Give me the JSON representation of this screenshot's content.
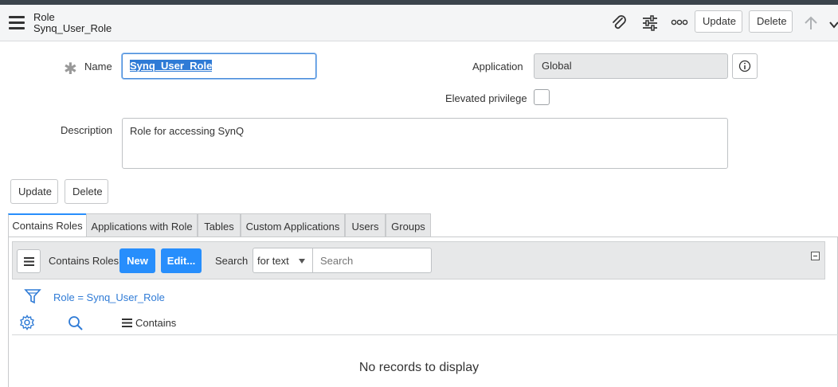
{
  "header": {
    "title": "Role",
    "subtitle": "Synq_User_Role",
    "update_label": "Update",
    "delete_label": "Delete"
  },
  "form": {
    "name_label": "Name",
    "name_value": "Synq_User_Role",
    "application_label": "Application",
    "application_value": "Global",
    "elevated_label": "Elevated privilege",
    "elevated_checked": false,
    "description_label": "Description",
    "description_value": "Role for accessing SynQ",
    "update_label": "Update",
    "delete_label": "Delete"
  },
  "tabs": [
    {
      "label": "Contains Roles",
      "active": true
    },
    {
      "label": "Applications with Role",
      "active": false
    },
    {
      "label": "Tables",
      "active": false
    },
    {
      "label": "Custom Applications",
      "active": false
    },
    {
      "label": "Users",
      "active": false
    },
    {
      "label": "Groups",
      "active": false
    }
  ],
  "related_list": {
    "title": "Contains Roles",
    "new_label": "New",
    "edit_label": "Edit...",
    "search_label": "Search",
    "search_field_option": "for text",
    "search_placeholder": "Search",
    "filter_text": "Role = Synq_User_Role",
    "column_header": "Contains",
    "empty_message": "No records to display"
  },
  "colors": {
    "accent": "#278efc",
    "link": "#2f7bd6",
    "topbar": "#3b444c"
  }
}
